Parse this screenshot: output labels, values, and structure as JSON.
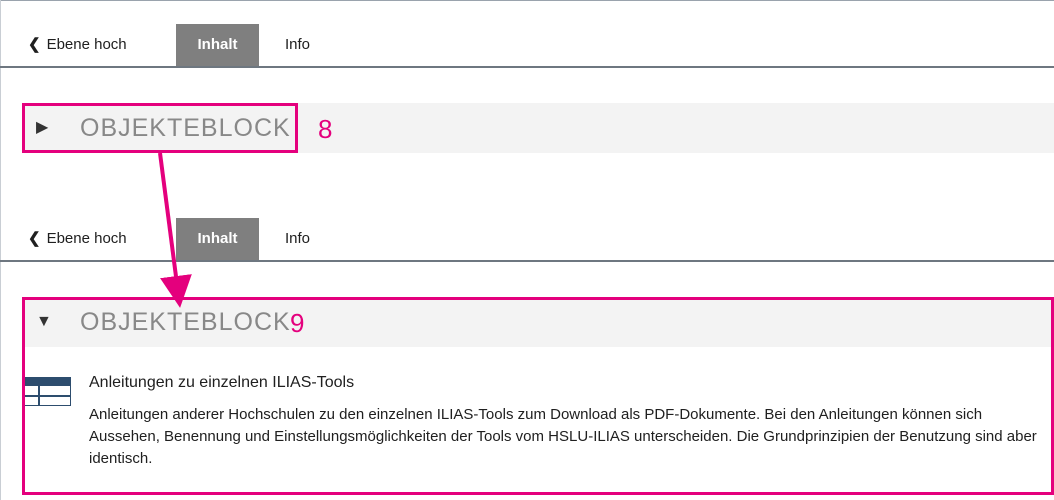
{
  "nav": {
    "back_label": "Ebene hoch",
    "tab_content": "Inhalt",
    "tab_info": "Info"
  },
  "block": {
    "title": "OBJEKTEBLOCK",
    "collapsed_marker": "8",
    "expanded_marker": "9"
  },
  "item": {
    "title": "Anleitungen zu einzelnen ILIAS-Tools",
    "description": "Anleitungen anderer Hochschulen zu den einzelnen ILIAS-Tools zum Download als PDF-Dokumente. Bei den Anleitungen können sich Aussehen, Benennung und Einstellungsmöglichkeiten der Tools vom HSLU-ILIAS unterscheiden. Die Grundprinzipien der Benutzung sind aber identisch."
  },
  "colors": {
    "highlight": "#e4007d",
    "active_tab": "#7f7f7f",
    "block_bg": "#f3f3f3"
  },
  "icons": [
    "chevron-left-icon",
    "triangle-right-icon",
    "triangle-down-icon",
    "table-icon"
  ]
}
